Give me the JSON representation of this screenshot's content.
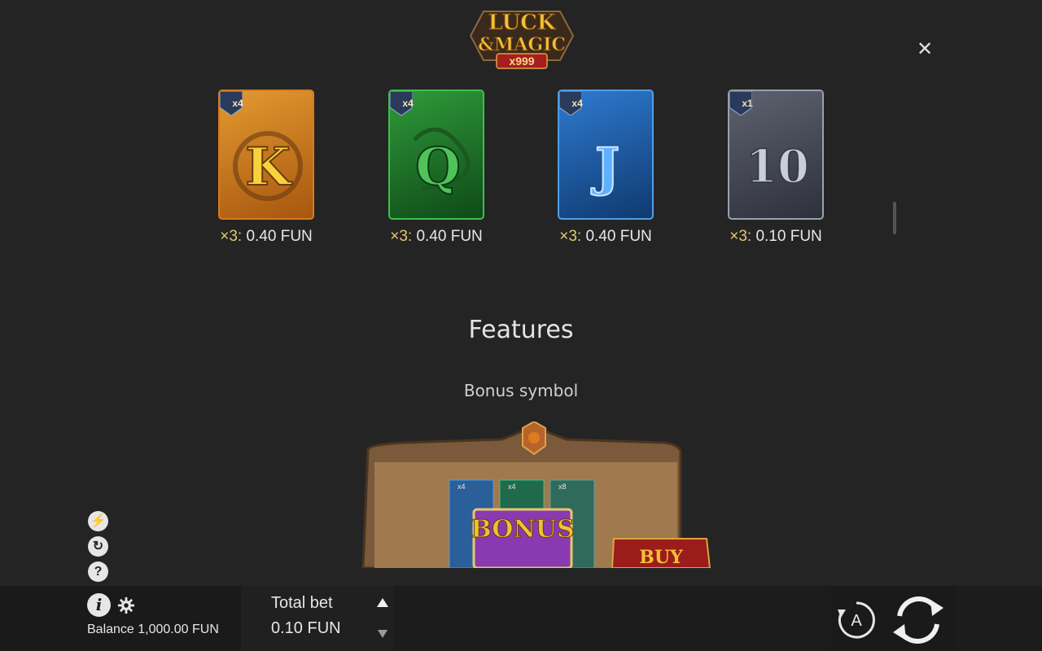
{
  "header": {
    "logo_line1": "LUCK",
    "logo_line2": "&MAGIC",
    "logo_line3": "x999",
    "close_label": "✕"
  },
  "symbols": [
    {
      "letter": "K",
      "badge": "x4",
      "mult": "×3:",
      "value": "0.40 FUN",
      "color": "#c9731c",
      "border": "#e08a2a",
      "icon": "k-symbol-icon"
    },
    {
      "letter": "Q",
      "badge": "x4",
      "mult": "×3:",
      "value": "0.40 FUN",
      "color": "#1f7a2a",
      "border": "#3fbf4a",
      "icon": "q-symbol-icon"
    },
    {
      "letter": "J",
      "badge": "x4",
      "mult": "×3:",
      "value": "0.40 FUN",
      "color": "#1d5fa8",
      "border": "#4f9ee6",
      "icon": "j-symbol-icon"
    },
    {
      "letter": "10",
      "badge": "x1",
      "mult": "×3:",
      "value": "0.10 FUN",
      "color": "#4a4e5c",
      "border": "#9aa0ae",
      "icon": "ten-symbol-icon"
    }
  ],
  "features": {
    "title": "Features",
    "subtitle": "Bonus symbol",
    "bonus_label": "BONUS",
    "buy_label": "BUY",
    "mini_badges": [
      "x4",
      "x4",
      "x8"
    ]
  },
  "side_icons": {
    "turbo": "⚡",
    "autoplay": "↻",
    "help": "?"
  },
  "bottom": {
    "info_label": "i",
    "balance": "Balance 1,000.00 FUN",
    "bet_label": "Total bet",
    "bet_value": "0.10 FUN",
    "auto_label": "A"
  },
  "colors": {
    "background": "#242424",
    "gold": "#e6c96a",
    "buy_red": "#9c1c1c"
  }
}
